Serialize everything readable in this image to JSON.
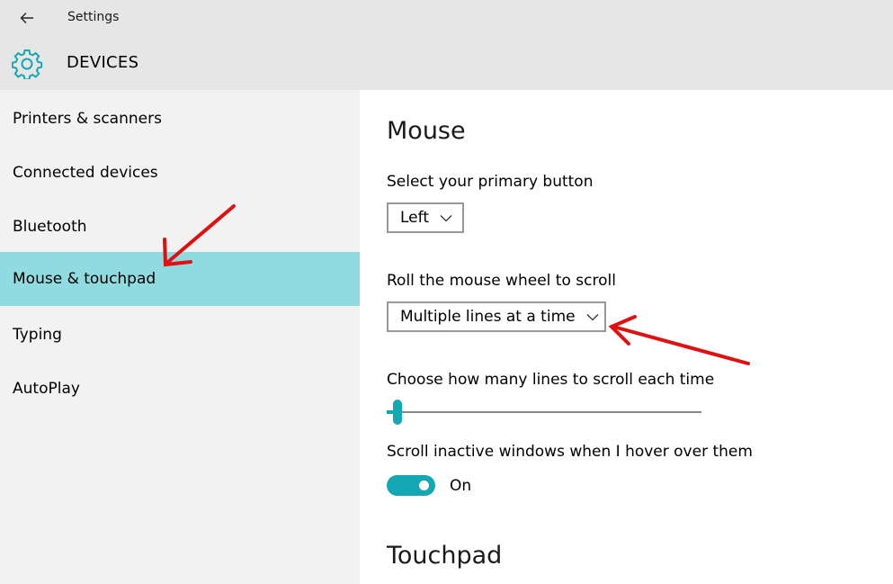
{
  "app": {
    "title": "Settings",
    "section": "DEVICES"
  },
  "icons": {
    "back": "back-arrow-icon",
    "settings": "gear-icon",
    "dropdown": "chevron-down-icon"
  },
  "colors": {
    "accent": "#13a8b3",
    "selected_nav": "#8fdbe0",
    "header_bg": "#e6e6e6",
    "sidebar_bg": "#f2f2f2",
    "annotation_arrow": "#e01010"
  },
  "sidebar": {
    "items": [
      {
        "label": "Printers & scanners",
        "selected": false
      },
      {
        "label": "Connected devices",
        "selected": false
      },
      {
        "label": "Bluetooth",
        "selected": false
      },
      {
        "label": "Mouse & touchpad",
        "selected": true
      },
      {
        "label": "Typing",
        "selected": false
      },
      {
        "label": "AutoPlay",
        "selected": false
      }
    ]
  },
  "main": {
    "mouse_heading": "Mouse",
    "primary_button": {
      "label": "Select your primary button",
      "value": "Left"
    },
    "wheel_scroll": {
      "label": "Roll the mouse wheel to scroll",
      "value": "Multiple lines at a time"
    },
    "lines_slider": {
      "label": "Choose how many lines to scroll each time"
    },
    "inactive_scroll": {
      "label": "Scroll inactive windows when I hover over them",
      "state": "On"
    },
    "touchpad_heading": "Touchpad"
  }
}
